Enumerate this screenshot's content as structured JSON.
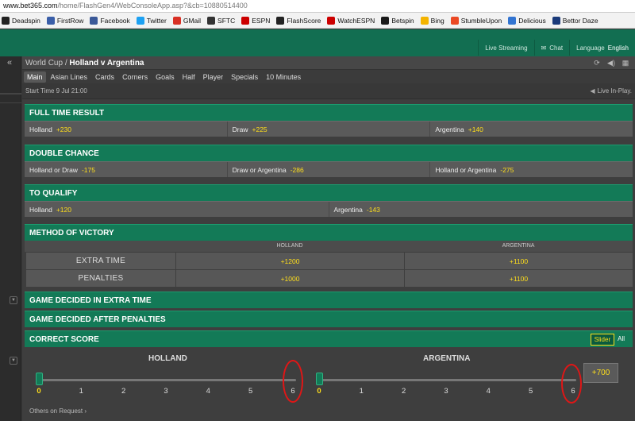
{
  "browser": {
    "url_host": "www.bet365.com",
    "url_path": "/home/FlashGen4/WebConsoleApp.asp?&cb=10880514400",
    "bookmarks": [
      {
        "label": "Deadspin",
        "color": "#222222"
      },
      {
        "label": "FirstRow",
        "color": "#3a5ea8"
      },
      {
        "label": "Facebook",
        "color": "#3b5998"
      },
      {
        "label": "Twitter",
        "color": "#1da1f2"
      },
      {
        "label": "GMail",
        "color": "#d93025"
      },
      {
        "label": "SFTC",
        "color": "#333333"
      },
      {
        "label": "ESPN",
        "color": "#cc0000"
      },
      {
        "label": "FlashScore",
        "color": "#222222"
      },
      {
        "label": "WatchESPN",
        "color": "#cc0000"
      },
      {
        "label": "Betspin",
        "color": "#1a1a1a"
      },
      {
        "label": "Bing",
        "color": "#f4b400"
      },
      {
        "label": "StumbleUpon",
        "color": "#eb4924"
      },
      {
        "label": "Delicious",
        "color": "#3274d1"
      },
      {
        "label": "Bettor Daze",
        "color": "#1a3a7a"
      }
    ]
  },
  "header": {
    "live_streaming": "Live Streaming",
    "chat": "Chat",
    "language_label": "Language",
    "language_value": "English"
  },
  "event": {
    "competition": "World Cup /",
    "match": "Holland v Argentina",
    "start_time": "Start Time 9 Jul 21:00",
    "live_inplay": "Live In-Play."
  },
  "tabs": [
    "Main",
    "Asian Lines",
    "Cards",
    "Corners",
    "Goals",
    "Half",
    "Player",
    "Specials",
    "10 Minutes"
  ],
  "markets": {
    "full_time": {
      "title": "FULL TIME RESULT",
      "cells": [
        {
          "label": "Holland",
          "odds": "+230"
        },
        {
          "label": "Draw",
          "odds": "+225"
        },
        {
          "label": "Argentina",
          "odds": "+140"
        }
      ]
    },
    "double_chance": {
      "title": "DOUBLE CHANCE",
      "cells": [
        {
          "label": "Holland or Draw",
          "odds": "-175"
        },
        {
          "label": "Draw or Argentina",
          "odds": "-286"
        },
        {
          "label": "Holland or Argentina",
          "odds": "-275"
        }
      ]
    },
    "to_qualify": {
      "title": "TO QUALIFY",
      "cells": [
        {
          "label": "Holland",
          "odds": "+120"
        },
        {
          "label": "Argentina",
          "odds": "-143"
        }
      ]
    },
    "method_of_victory": {
      "title": "METHOD OF VICTORY",
      "col_holland": "HOLLAND",
      "col_argentina": "ARGENTINA",
      "rows": [
        {
          "label": "EXTRA TIME",
          "holland": "+1200",
          "argentina": "+1100"
        },
        {
          "label": "PENALTIES",
          "holland": "+1000",
          "argentina": "+1100"
        }
      ]
    },
    "decided_extra": {
      "title": "GAME DECIDED IN EXTRA TIME"
    },
    "decided_penalties": {
      "title": "GAME DECIDED AFTER PENALTIES"
    },
    "correct_score": {
      "title": "CORRECT SCORE",
      "toggle_slider": "Slider",
      "toggle_all": "All",
      "team_home": "HOLLAND",
      "team_away": "ARGENTINA",
      "ticks": [
        "0",
        "1",
        "2",
        "3",
        "4",
        "5",
        "6"
      ],
      "home_selected": 0,
      "away_selected": 0,
      "price": "+700",
      "others": "Others on Request"
    }
  }
}
